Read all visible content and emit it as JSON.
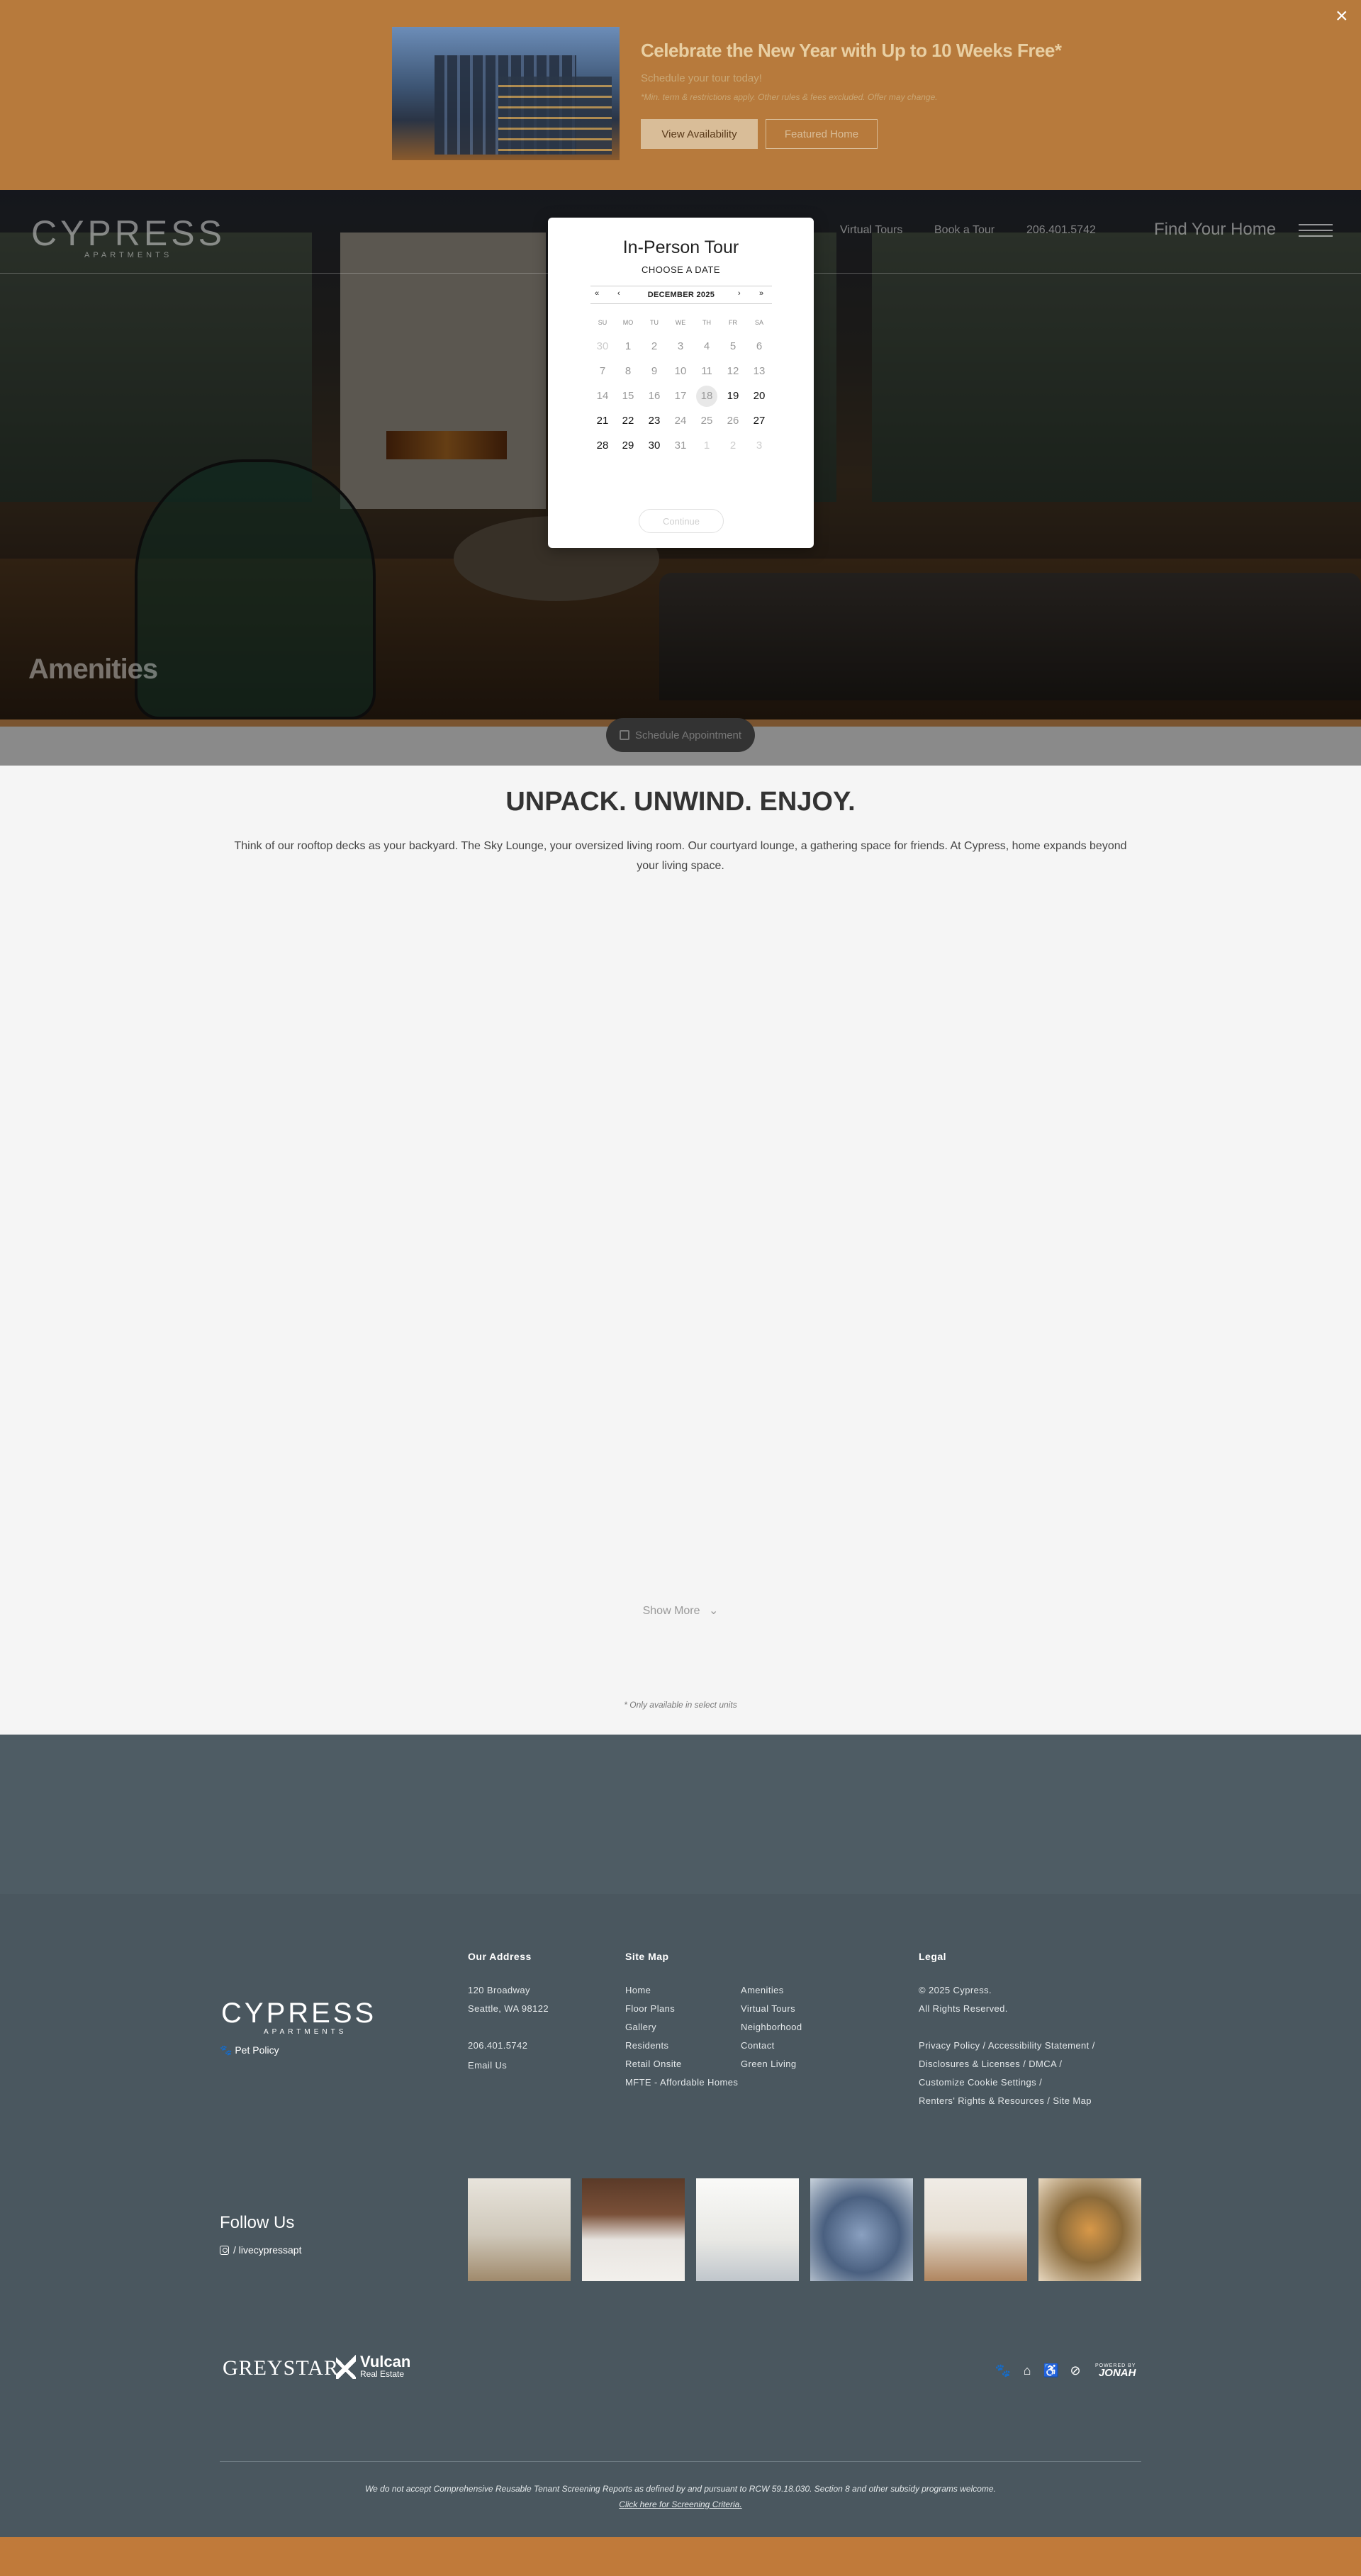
{
  "promo": {
    "title": "Celebrate the New Year with Up to 10 Weeks Free*",
    "subtitle": "Schedule your tour today!",
    "note": "*Min. term & restrictions apply. Other rules & fees excluded. Offer may change.",
    "primary_button": "View Availability",
    "secondary_button": "Featured Home",
    "close_icon": "×"
  },
  "header": {
    "logo_word": "CYPRESS",
    "logo_sub": "APARTMENTS",
    "nav": [
      "Virtual Tours",
      "Book a Tour",
      "206.401.5742"
    ],
    "find_home": "Find Your Home",
    "menu_icon": "hamburger-icon"
  },
  "hero": {
    "title": "Amenities"
  },
  "schedule_button": {
    "label": "Schedule Appointment",
    "icon": "calendar-icon"
  },
  "tour_modal": {
    "title": "In-Person Tour",
    "subtitle": "CHOOSE A DATE",
    "month": "DECEMBER 2025",
    "nav": {
      "first": "«",
      "prev": "‹",
      "next": "›",
      "last": "»"
    },
    "weekdays": [
      "SU",
      "MO",
      "TU",
      "WE",
      "TH",
      "FR",
      "SA"
    ],
    "weeks": [
      [
        "30",
        "1",
        "2",
        "3",
        "4",
        "5",
        "6"
      ],
      [
        "7",
        "8",
        "9",
        "10",
        "11",
        "12",
        "13"
      ],
      [
        "14",
        "15",
        "16",
        "17",
        "18",
        "19",
        "20"
      ],
      [
        "21",
        "22",
        "23",
        "24",
        "25",
        "26",
        "27"
      ],
      [
        "28",
        "29",
        "30",
        "31",
        "1",
        "2",
        "3"
      ]
    ],
    "today": "18",
    "continue_label": "Continue"
  },
  "content": {
    "heading": "UNPACK. UNWIND. ENJOY.",
    "body": "Think of our rooftop decks as your backyard. The Sky Lounge, your oversized living room. Our courtyard lounge, a gathering space for friends. At Cypress, home expands beyond your living space.",
    "show_more": "Show More",
    "note": "* Only available in select units"
  },
  "footer": {
    "logo_word": "CYPRESS",
    "logo_sub": "APARTMENTS",
    "pet_policy": "Pet Policy",
    "address": {
      "heading": "Our Address",
      "line1": "120 Broadway",
      "line2": "Seattle, WA 98122",
      "phone": "206.401.5742",
      "email": "Email Us"
    },
    "sitemap": {
      "heading": "Site Map",
      "col1": [
        "Home",
        "Floor Plans",
        "Gallery",
        "Residents",
        "Retail Onsite",
        "MFTE - Affordable Homes"
      ],
      "col2": [
        "Amenities",
        "Virtual Tours",
        "Neighborhood",
        "Contact",
        "Green Living"
      ]
    },
    "legal": {
      "heading": "Legal",
      "copyright": "© 2025 Cypress.",
      "rights": "All Rights Reserved.",
      "line1": "Privacy Policy  /  Accessibility Statement  /",
      "line2": "Disclosures & Licenses  /  DMCA  /",
      "line3": "Customize Cookie Settings  /",
      "line4": "Renters' Rights & Resources  /  Site Map"
    },
    "follow": {
      "heading": "Follow Us",
      "handle": "/  livecypressapt"
    },
    "partners": {
      "greystar": "GREYSTAR",
      "vulcan_1": "Vulcan",
      "vulcan_2": "Real Estate"
    },
    "powered_by": "POWERED BY",
    "jonah": "JONAH",
    "disclaimer": "We do not accept Comprehensive Reusable Tenant Screening Reports as defined by and pursuant to RCW 59.18.030. Section 8 and other subsidy programs welcome.",
    "criteria_link": "Click here for Screening Criteria."
  },
  "colors": {
    "promo_bg": "#b77a3c",
    "footer_bg": "#4a575f",
    "accent_bottom": "#c07a3a"
  }
}
